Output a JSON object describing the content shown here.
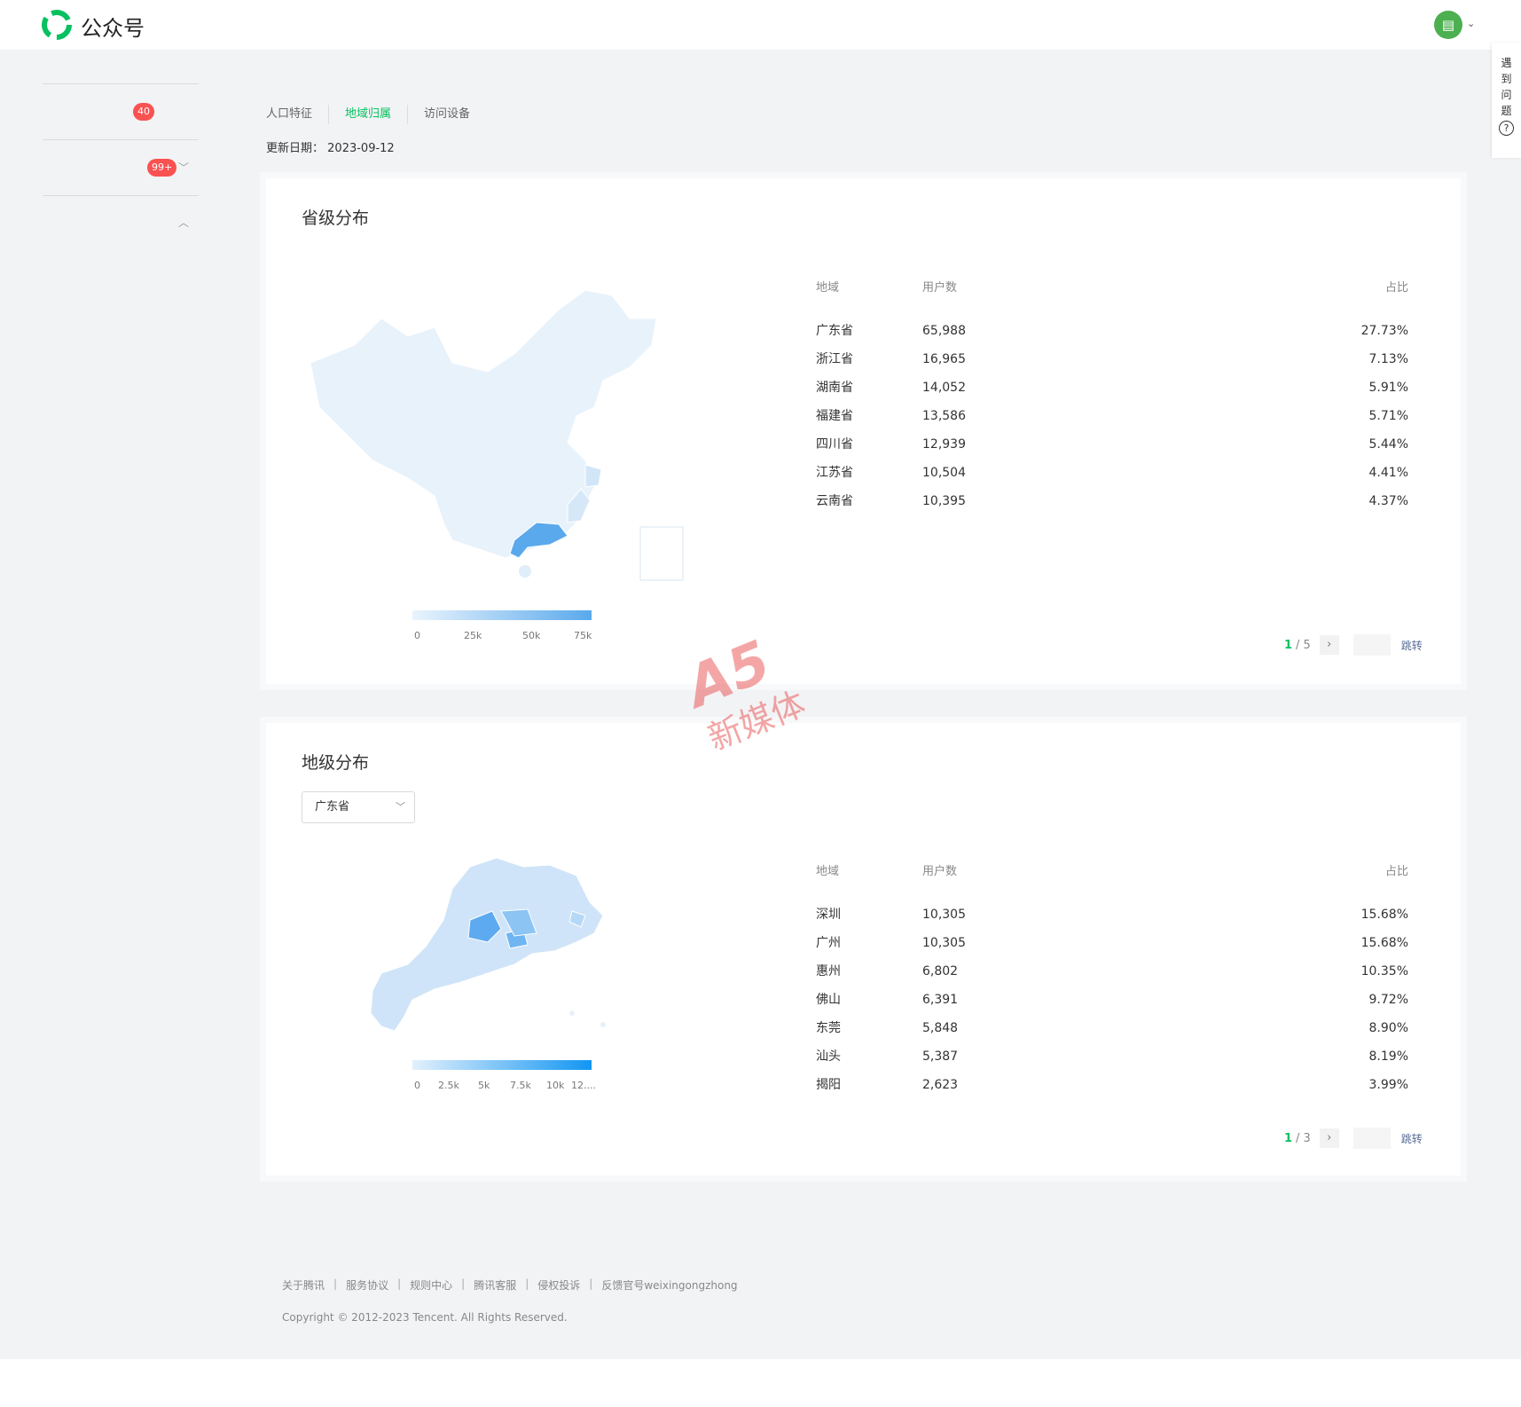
{
  "app": {
    "brand": "公众号"
  },
  "topbar": {
    "avatar_icon": "document-icon",
    "caret": "⌄"
  },
  "sidebar": {
    "badges": [
      "40",
      "99+"
    ]
  },
  "tabs": [
    {
      "label": "人口特征",
      "active": false
    },
    {
      "label": "地域归属",
      "active": true
    },
    {
      "label": "访问设备",
      "active": false
    }
  ],
  "update": {
    "label": "更新日期：",
    "date": "2023-09-12"
  },
  "province_card": {
    "title": "省级分布",
    "legend": [
      "0",
      "25k",
      "50k",
      "75k"
    ],
    "headers": {
      "region": "地域",
      "users": "用户数",
      "ratio": "占比"
    },
    "rows": [
      {
        "region": "广东省",
        "users": "65,988",
        "ratio": "27.73%"
      },
      {
        "region": "浙江省",
        "users": "16,965",
        "ratio": "7.13%"
      },
      {
        "region": "湖南省",
        "users": "14,052",
        "ratio": "5.91%"
      },
      {
        "region": "福建省",
        "users": "13,586",
        "ratio": "5.71%"
      },
      {
        "region": "四川省",
        "users": "12,939",
        "ratio": "5.44%"
      },
      {
        "region": "江苏省",
        "users": "10,504",
        "ratio": "4.41%"
      },
      {
        "region": "云南省",
        "users": "10,395",
        "ratio": "4.37%"
      }
    ],
    "pager": {
      "current": "1",
      "total": "5",
      "jump": "跳转"
    }
  },
  "city_card": {
    "title": "地级分布",
    "select": "广东省",
    "legend": [
      "0",
      "2.5k",
      "5k",
      "7.5k",
      "10k",
      "12...."
    ],
    "headers": {
      "region": "地域",
      "users": "用户数",
      "ratio": "占比"
    },
    "rows": [
      {
        "region": "深圳",
        "users": "10,305",
        "ratio": "15.68%"
      },
      {
        "region": "广州",
        "users": "10,305",
        "ratio": "15.68%"
      },
      {
        "region": "惠州",
        "users": "6,802",
        "ratio": "10.35%"
      },
      {
        "region": "佛山",
        "users": "6,391",
        "ratio": "9.72%"
      },
      {
        "region": "东莞",
        "users": "5,848",
        "ratio": "8.90%"
      },
      {
        "region": "汕头",
        "users": "5,387",
        "ratio": "8.19%"
      },
      {
        "region": "揭阳",
        "users": "2,623",
        "ratio": "3.99%"
      }
    ],
    "pager": {
      "current": "1",
      "total": "3",
      "jump": "跳转"
    }
  },
  "helper": {
    "text": [
      "遇",
      "到",
      "问",
      "题"
    ],
    "icon": "?"
  },
  "footer": {
    "links": [
      "关于腾讯",
      "服务协议",
      "规则中心",
      "腾讯客服",
      "侵权投诉",
      "反馈官号weixingongzhong"
    ],
    "copyright": "Copyright © 2012-2023 Tencent. All Rights Reserved."
  },
  "watermark": {
    "logo": "A5",
    "text": "新媒体"
  },
  "colors": {
    "accent": "#07c160",
    "map_low": "#e8f3fd",
    "map_high": "#4da8ee",
    "badge": "#fa5151"
  }
}
